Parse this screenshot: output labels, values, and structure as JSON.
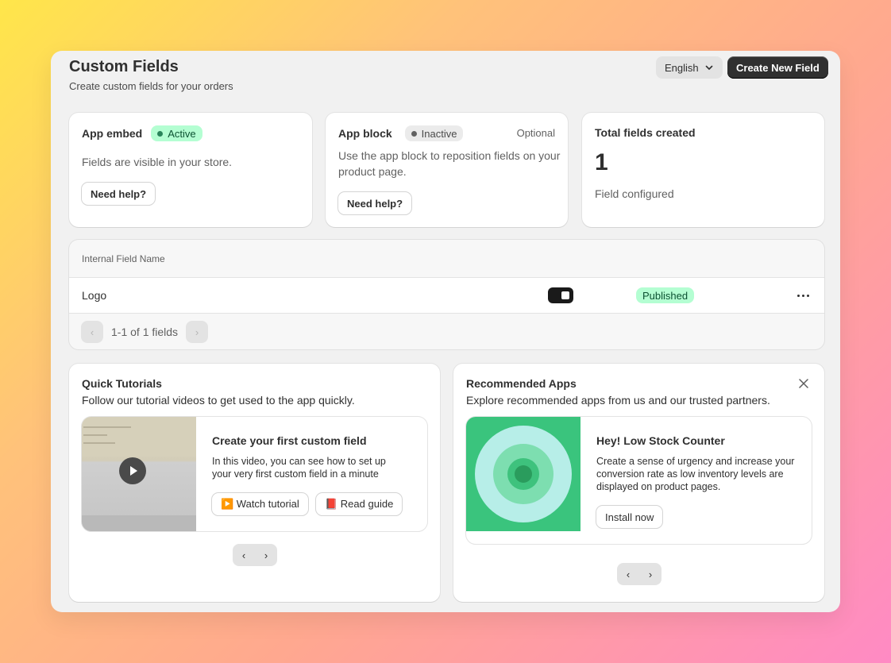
{
  "header": {
    "title": "Custom Fields",
    "subtitle": "Create custom fields for your orders",
    "language": "English",
    "create_label": "Create New Field"
  },
  "app_embed": {
    "title": "App embed",
    "badge": "Active",
    "text": "Fields are visible in your store.",
    "help_label": "Need help?"
  },
  "app_block": {
    "title": "App block",
    "badge": "Inactive",
    "optional": "Optional",
    "text": "Use the app block to reposition fields on your product page.",
    "help_label": "Need help?"
  },
  "total": {
    "title": "Total fields created",
    "count": "1",
    "caption": "Field configured"
  },
  "table": {
    "header": "Internal Field Name",
    "rows": [
      {
        "name": "Logo",
        "enabled": true,
        "status": "Published"
      }
    ],
    "pagination": "1-1 of 1 fields"
  },
  "tutorials": {
    "title": "Quick Tutorials",
    "subtitle": "Follow our tutorial videos to get used to the app quickly.",
    "item": {
      "title": "Create your first custom field",
      "text": "In this video, you can see how to set up your very first custom field in a minute",
      "watch_label": "▶️ Watch tutorial",
      "read_label": "📕 Read guide"
    }
  },
  "recommended": {
    "title": "Recommended Apps",
    "subtitle": "Explore recommended apps from us and our trusted partners.",
    "item": {
      "title": "Hey! Low Stock Counter",
      "text": "Create a sense of urgency and increase your conversion rate as low inventory levels are displayed on product pages.",
      "install_label": "Install now"
    }
  },
  "icons": {
    "chevron_down": "chevron-down-icon",
    "close": "close-icon",
    "play": "play-icon",
    "more": "more-horizontal-icon"
  },
  "colors": {
    "primary": "#303030",
    "success_bg": "#b4fed2",
    "success_text": "#0c5132",
    "app_green": "#3ac47d"
  }
}
